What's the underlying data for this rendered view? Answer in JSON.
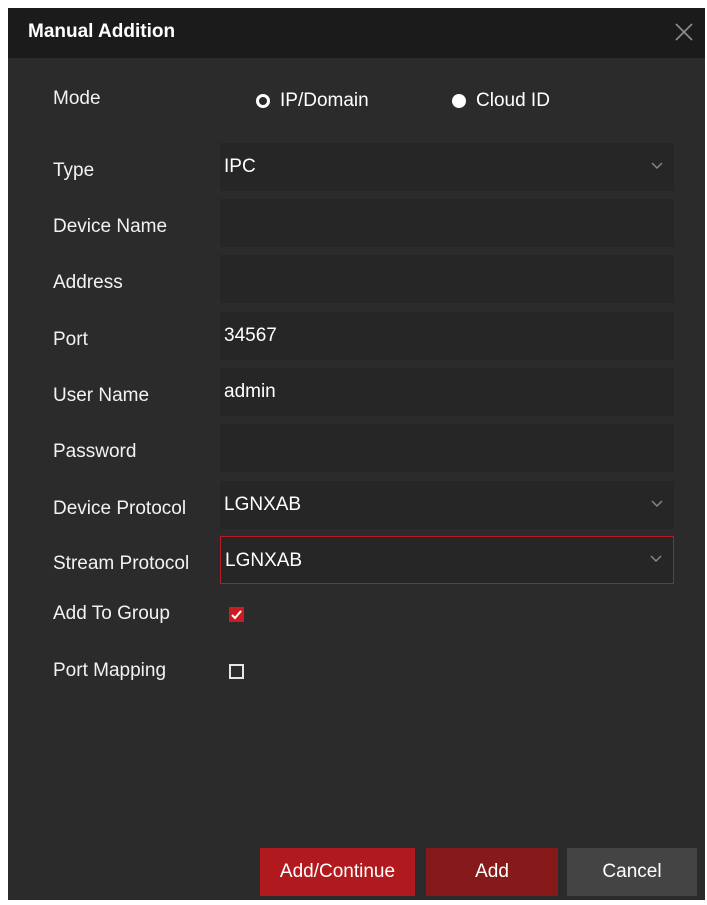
{
  "dialog": {
    "title": "Manual Addition"
  },
  "mode": {
    "label": "Mode",
    "options": [
      "IP/Domain",
      "Cloud ID"
    ],
    "selected": "Cloud ID"
  },
  "form": {
    "type": {
      "label": "Type",
      "value": "IPC"
    },
    "device_name": {
      "label": "Device Name",
      "value": ""
    },
    "address": {
      "label": "Address",
      "value": ""
    },
    "port": {
      "label": "Port",
      "value": "34567"
    },
    "user_name": {
      "label": "User Name",
      "value": "admin"
    },
    "password": {
      "label": "Password",
      "value": ""
    },
    "device_protocol": {
      "label": "Device Protocol",
      "value": "LGNXAB"
    },
    "stream_protocol": {
      "label": "Stream Protocol",
      "value": "LGNXAB"
    },
    "add_to_group": {
      "label": "Add To Group",
      "checked": true
    },
    "port_mapping": {
      "label": "Port Mapping",
      "checked": false
    }
  },
  "buttons": {
    "add_continue": "Add/Continue",
    "add": "Add",
    "cancel": "Cancel"
  },
  "colors": {
    "accent": "#b01a1f",
    "background": "#2b2b2b",
    "title_bar": "#1b1b1b"
  }
}
